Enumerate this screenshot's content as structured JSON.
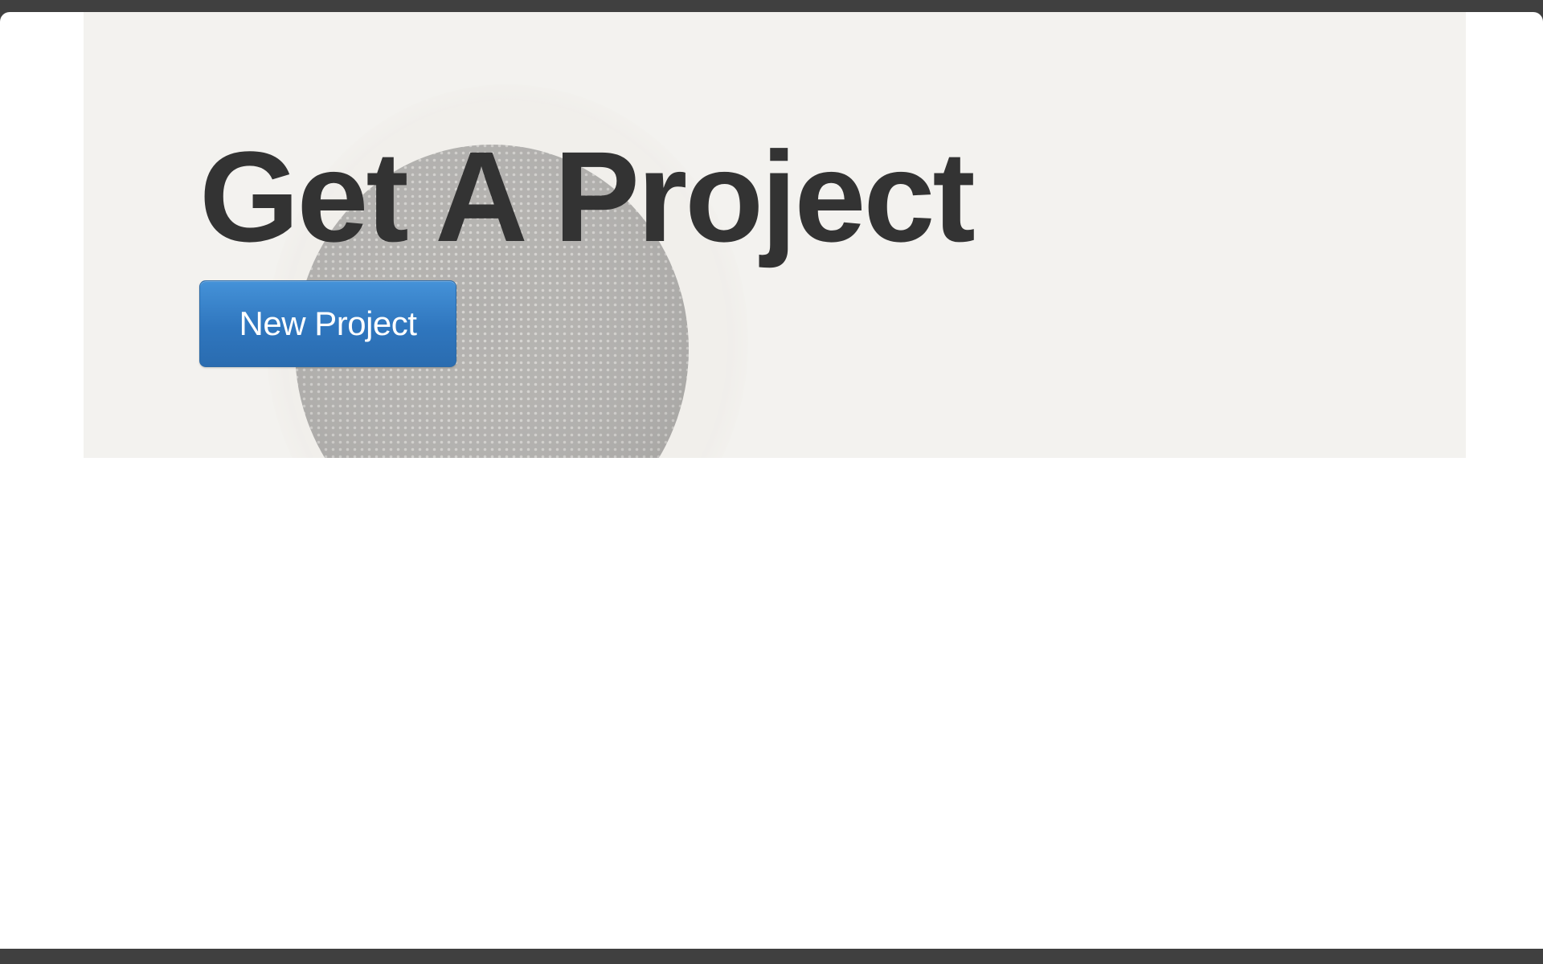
{
  "hero": {
    "title": "Get A Project",
    "background_image": "speaker-grille-photo"
  },
  "actions": {
    "new_project_label": "New Project"
  },
  "colors": {
    "frame": "#404040",
    "page_background": "#ffffff",
    "hero_background": "#f3f2ef",
    "title_text": "#333333",
    "primary_button": "#337ab7",
    "primary_button_text": "#ffffff"
  }
}
